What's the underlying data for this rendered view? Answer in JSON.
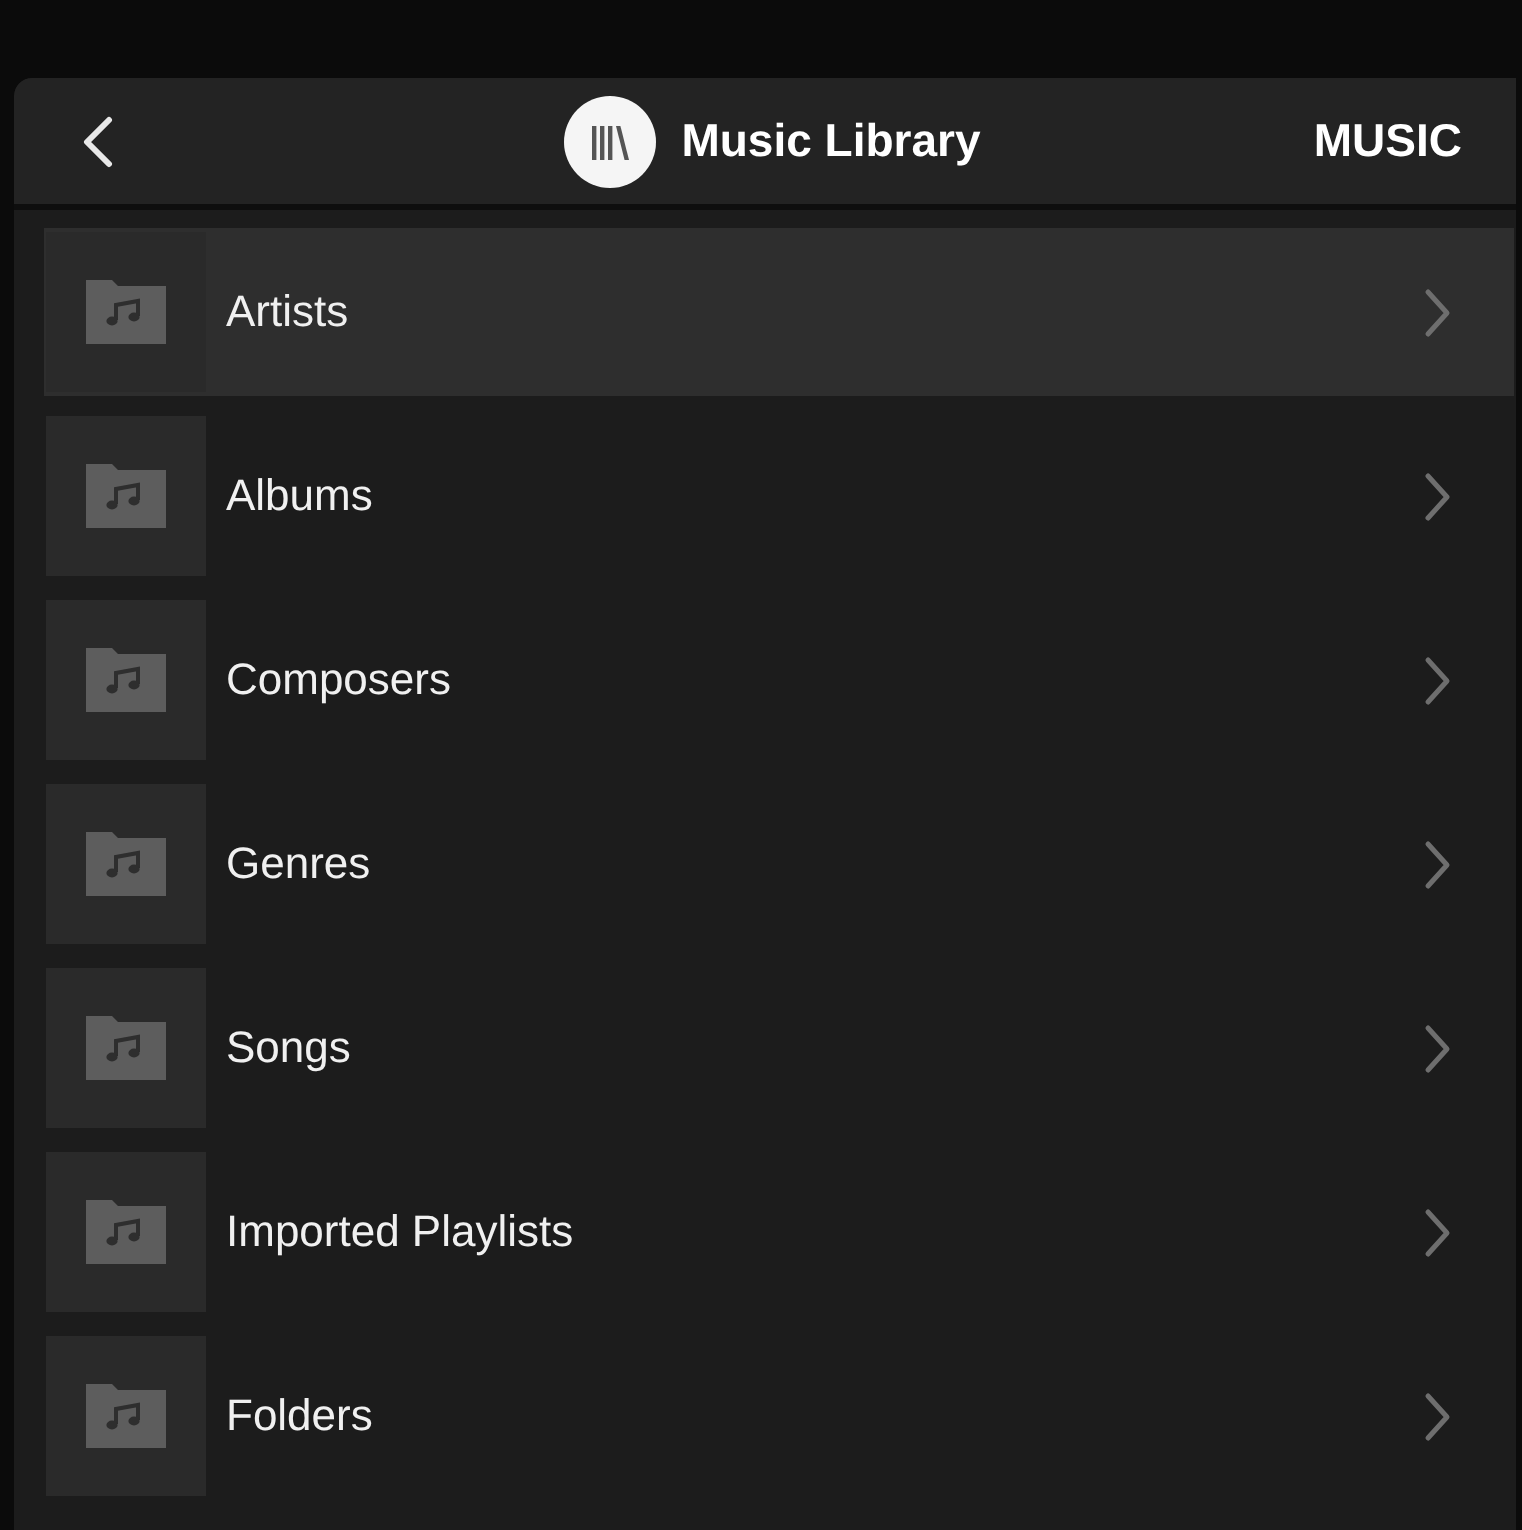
{
  "header": {
    "title": "Music Library",
    "section": "MUSIC"
  },
  "items": [
    {
      "label": "Artists",
      "selected": true
    },
    {
      "label": "Albums",
      "selected": false
    },
    {
      "label": "Composers",
      "selected": false
    },
    {
      "label": "Genres",
      "selected": false
    },
    {
      "label": "Songs",
      "selected": false
    },
    {
      "label": "Imported Playlists",
      "selected": false
    },
    {
      "label": "Folders",
      "selected": false
    }
  ]
}
